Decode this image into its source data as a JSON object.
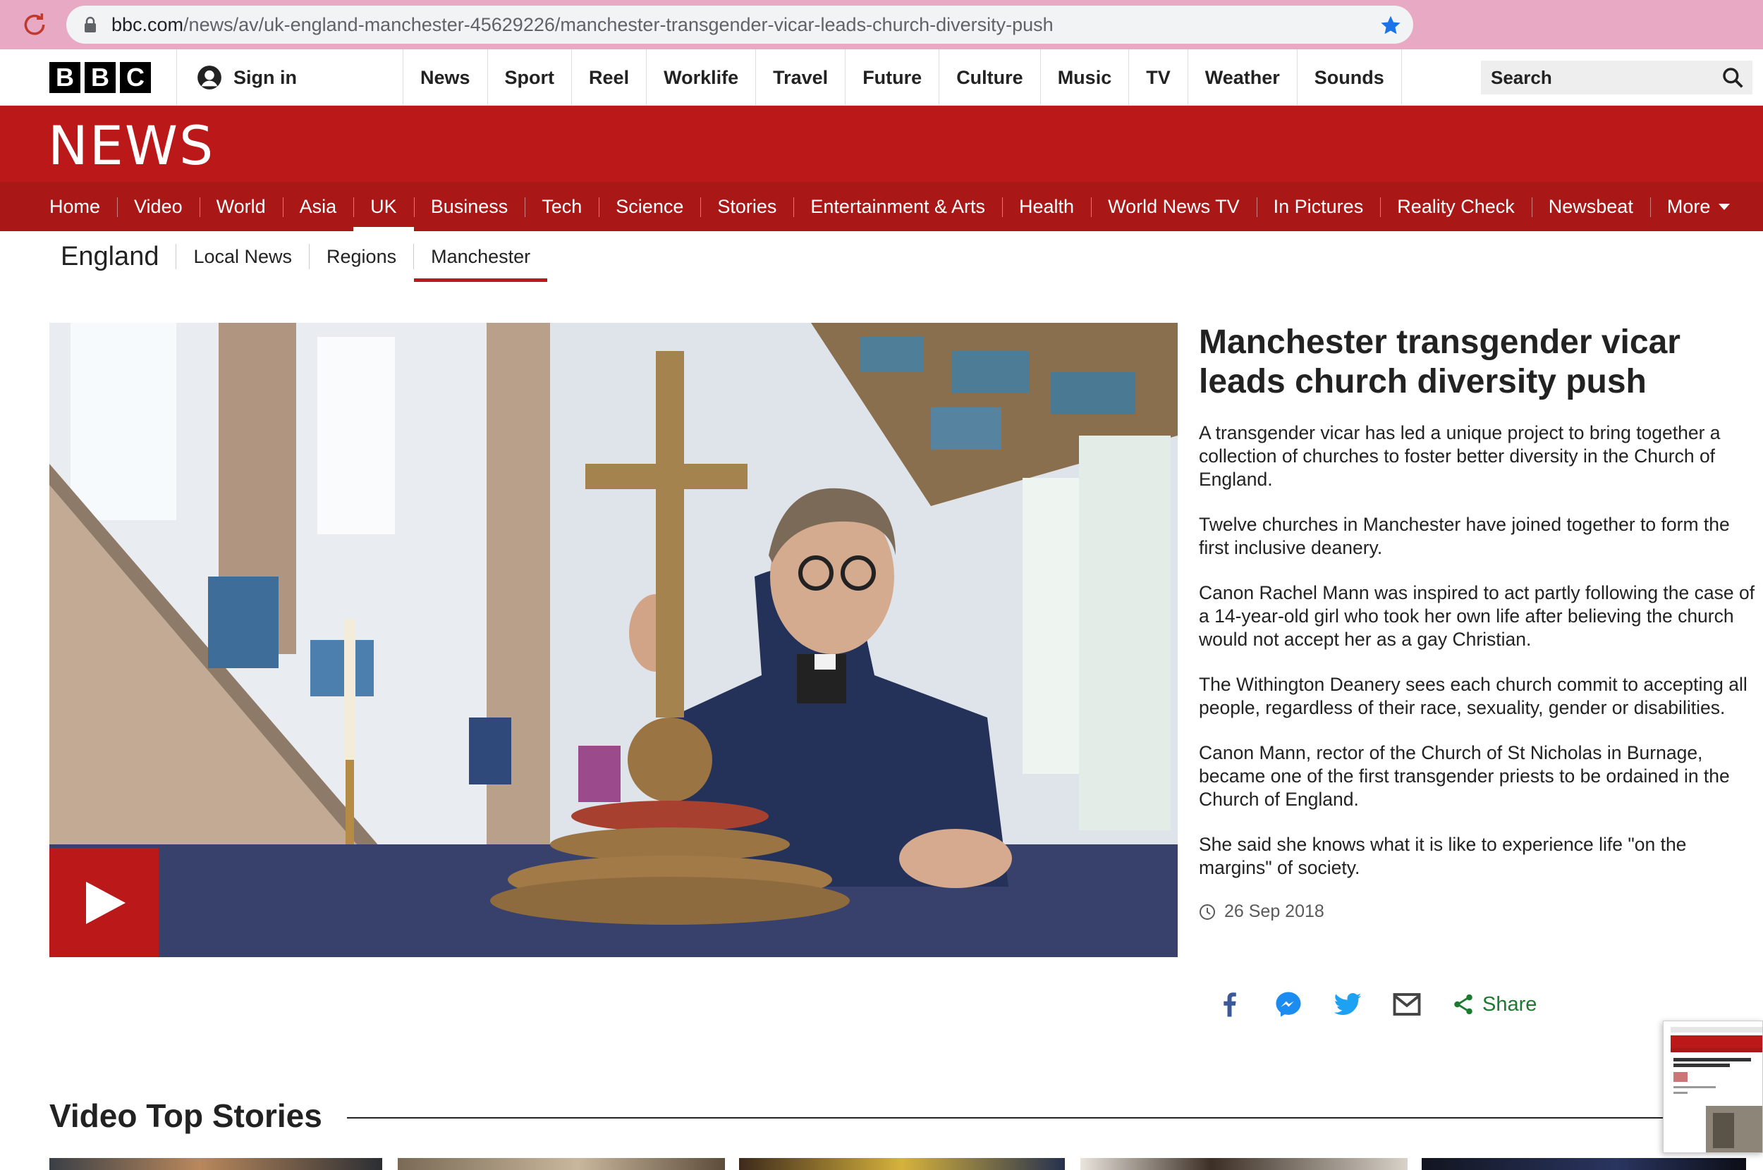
{
  "browser": {
    "url_host": "bbc.com",
    "url_path": "/news/av/uk-england-manchester-45629226/manchester-transgender-vicar-leads-church-diversity-push"
  },
  "masthead": {
    "logo_letters": [
      "B",
      "B",
      "C"
    ],
    "sign_in": "Sign in",
    "nav": [
      "News",
      "Sport",
      "Reel",
      "Worklife",
      "Travel",
      "Future",
      "Culture",
      "Music",
      "TV",
      "Weather",
      "Sounds"
    ],
    "search_placeholder": "Search"
  },
  "news": {
    "wordmark": "NEWS",
    "nav": [
      "Home",
      "Video",
      "World",
      "Asia",
      "UK",
      "Business",
      "Tech",
      "Science",
      "Stories",
      "Entertainment & Arts",
      "Health",
      "World News TV",
      "In Pictures",
      "Reality Check",
      "Newsbeat"
    ],
    "active_nav": "UK",
    "more": "More"
  },
  "subnav": {
    "section": "England",
    "items": [
      "Local News",
      "Regions",
      "Manchester"
    ],
    "active": "Manchester"
  },
  "article": {
    "headline": "Manchester transgender vicar leads church diversity push",
    "paragraphs": [
      "A transgender vicar has led a unique project to bring together a collection of churches to foster better diversity in the Church of England.",
      "Twelve churches in Manchester have joined together to form the first inclusive deanery.",
      "Canon Rachel Mann was inspired to act partly following the case of a 14-year-old girl who took her own life after believing the church would not accept her as a gay Christian.",
      "The Withington Deanery sees each church commit to accepting all people, regardless of their race, sexuality, gender or disabilities.",
      "Canon Mann, rector of the Church of St Nicholas in Burnage, became one of the first transgender priests to be ordained in the Church of England.",
      "She said she knows what it is like to experience life \"on the margins\" of society."
    ],
    "date": "26 Sep 2018",
    "share_label": "Share"
  },
  "video_top_stories": {
    "title": "Video Top Stories"
  },
  "colors": {
    "bbc_red": "#bb1919",
    "nav_red": "#a91717",
    "share_green": "#1c7a2e",
    "chrome_pink": "#e8a9c4"
  },
  "icons": [
    "reload-icon",
    "lock-icon",
    "bookmark-star-icon",
    "account-icon",
    "search-icon",
    "play-icon",
    "clock-icon",
    "facebook-icon",
    "messenger-icon",
    "twitter-icon",
    "email-icon",
    "share-icon"
  ]
}
